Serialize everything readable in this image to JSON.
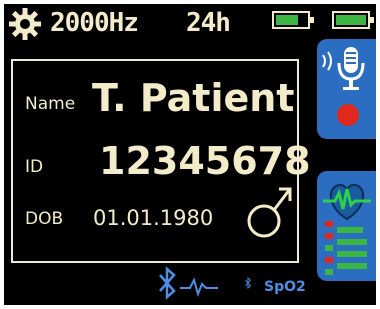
{
  "status_bar": {
    "frequency": "2000Hz",
    "duration": "24h",
    "icons": [
      "settings-gear-icon",
      "battery-icon",
      "battery-icon"
    ],
    "battery_color": "#3cb543"
  },
  "patient": {
    "name_label": "Name",
    "name_value": "T. Patient",
    "id_label": "ID",
    "id_value": "12345678",
    "dob_label": "DOB",
    "dob_value": "01.01.1980",
    "gender_icon": "male-symbol-icon"
  },
  "side_panels": {
    "record_icons": [
      "microphone-icon",
      "record-icon"
    ],
    "monitor_icons": [
      "ecg-heart-icon",
      "level-bars-icon"
    ],
    "panel_color": "#2b6ec1",
    "record_color": "#e0281c"
  },
  "bottom_bar": {
    "spo2_label": "SpO2",
    "bluetooth_color": "#4a8fe8",
    "icons": [
      "bluetooth-ecg-icon",
      "bluetooth-spo2-icon"
    ]
  }
}
